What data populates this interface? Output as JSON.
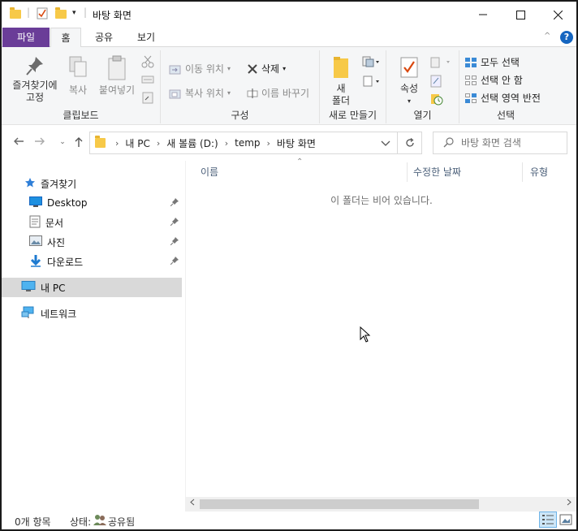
{
  "window": {
    "title": "바탕 화면"
  },
  "tabs": {
    "file": "파일",
    "home": "홈",
    "share": "공유",
    "view": "보기"
  },
  "ribbon": {
    "clipboard": {
      "label": "클립보드",
      "pin_line1": "즐겨찾기에",
      "pin_line2": "고정",
      "copy": "복사",
      "paste": "붙여넣기"
    },
    "organize": {
      "label": "구성",
      "move_to": "이동 위치",
      "copy_to": "복사 위치",
      "delete": "삭제",
      "rename": "이름 바꾸기"
    },
    "new": {
      "label": "새로 만들기",
      "new_folder_line1": "새",
      "new_folder_line2": "폴더"
    },
    "open": {
      "label": "열기",
      "properties": "속성"
    },
    "select": {
      "label": "선택",
      "select_all": "모두 선택",
      "select_none": "선택 안 함",
      "invert": "선택 영역 반전"
    }
  },
  "address": {
    "crumbs": [
      "내 PC",
      "새 볼륨 (D:)",
      "temp",
      "바탕 화면"
    ]
  },
  "search": {
    "placeholder": "바탕 화면 검색"
  },
  "nav": {
    "quick_access": "즐겨찾기",
    "desktop": "Desktop",
    "documents": "문서",
    "pictures": "사진",
    "downloads": "다운로드",
    "this_pc": "내 PC",
    "network": "네트워크"
  },
  "columns": {
    "name": "이름",
    "date": "수정한 날짜",
    "type": "유형"
  },
  "content": {
    "empty_message": "이 폴더는 비어 있습니다."
  },
  "status": {
    "count": "0개 항목",
    "state_label": "상태:",
    "state_value": "공유됨"
  },
  "colors": {
    "file_tab": "#6a3d98",
    "folder": "#f7c948",
    "selection": "#d9d9d9",
    "help": "#1565c0"
  }
}
